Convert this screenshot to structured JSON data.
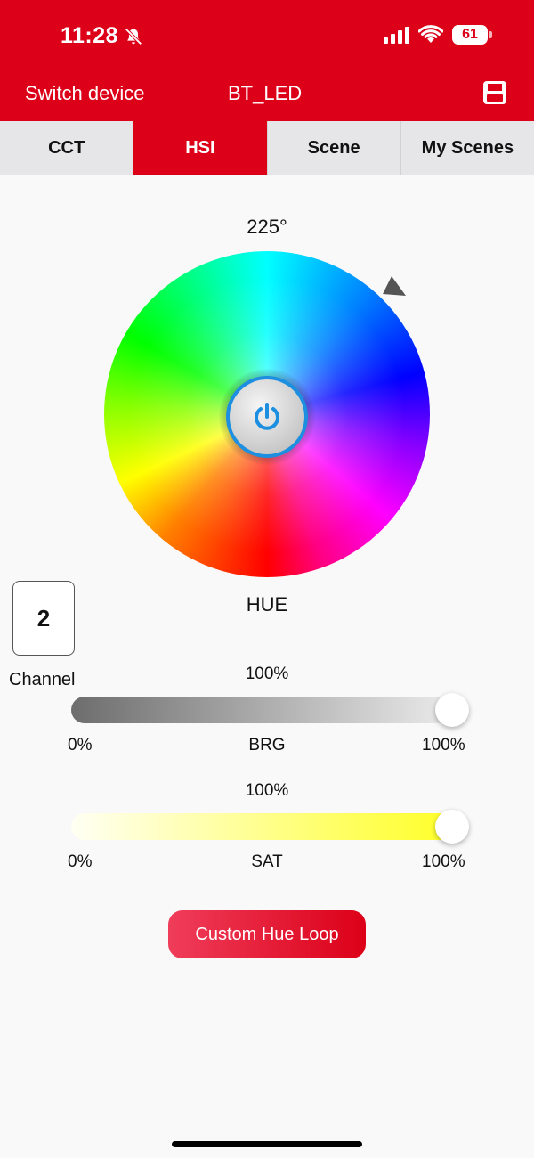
{
  "status_bar": {
    "time": "11:28",
    "battery": "61"
  },
  "header": {
    "switch_device": "Switch device",
    "device_name": "BT_LED"
  },
  "tabs": [
    {
      "label": "CCT",
      "active": false
    },
    {
      "label": "HSI",
      "active": true
    },
    {
      "label": "Scene",
      "active": false
    },
    {
      "label": "My Scenes",
      "active": false
    }
  ],
  "hue": {
    "degree_text": "225°",
    "value_deg": 225,
    "label": "HUE"
  },
  "channel": {
    "value": "2",
    "label": "Channel"
  },
  "brightness": {
    "value_text": "100%",
    "value": 100,
    "min_label": "0%",
    "label": "BRG",
    "max_label": "100%"
  },
  "saturation": {
    "value_text": "100%",
    "value": 100,
    "min_label": "0%",
    "label": "SAT",
    "max_label": "100%"
  },
  "custom_loop_label": "Custom Hue Loop",
  "colors": {
    "accent": "#dc0018",
    "power_ring": "#1d8fe0"
  },
  "icons": {
    "save": "save-icon",
    "power": "power-icon",
    "bell_muted": "bell-slash-icon",
    "wifi": "wifi-icon"
  }
}
